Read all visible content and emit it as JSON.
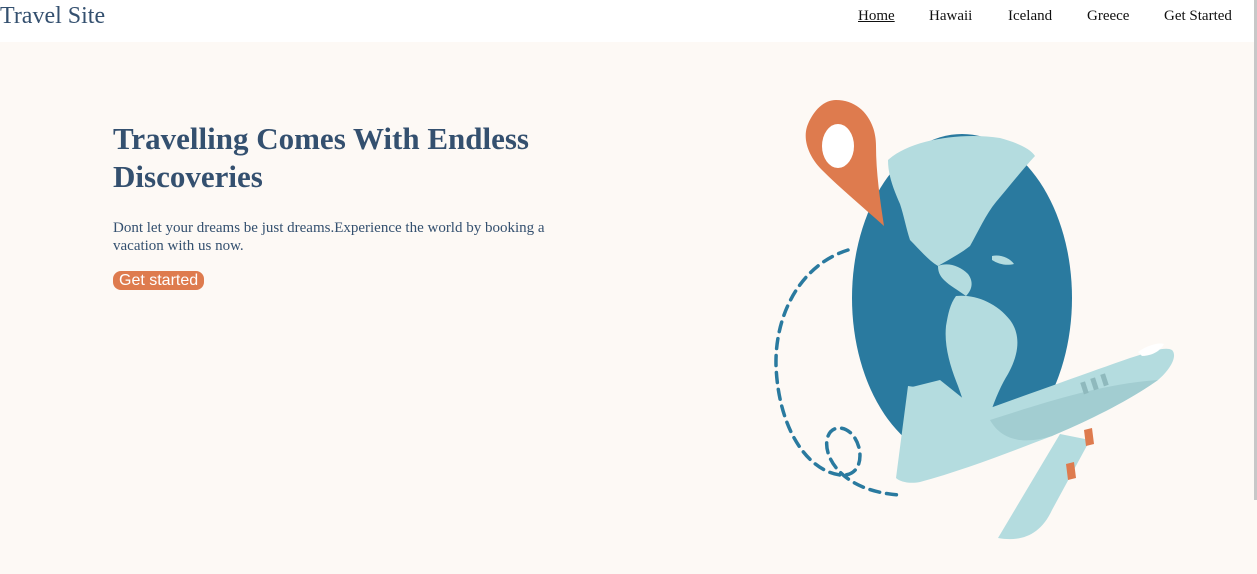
{
  "header": {
    "brand": "Travel Site",
    "nav": [
      {
        "label": "Home",
        "active": true
      },
      {
        "label": "Hawaii",
        "active": false
      },
      {
        "label": "Iceland",
        "active": false
      },
      {
        "label": "Greece",
        "active": false
      },
      {
        "label": "Get Started",
        "active": false
      }
    ]
  },
  "hero": {
    "title": "Travelling Comes With Endless Discoveries",
    "description": "Dont let your dreams be just dreams.Experience the world by booking a vacation with us now.",
    "cta_label": "Get started"
  },
  "illustration": {
    "icons": [
      "location-pin-icon",
      "globe-icon",
      "airplane-icon",
      "dashed-flight-path"
    ]
  },
  "colors": {
    "brand_text": "#34506f",
    "hero_background": "#fdf9f5",
    "accent": "#de7b4e",
    "globe_ocean": "#2a7a9f",
    "globe_land": "#b4dcdf",
    "airplane": "#b4dcdf"
  }
}
